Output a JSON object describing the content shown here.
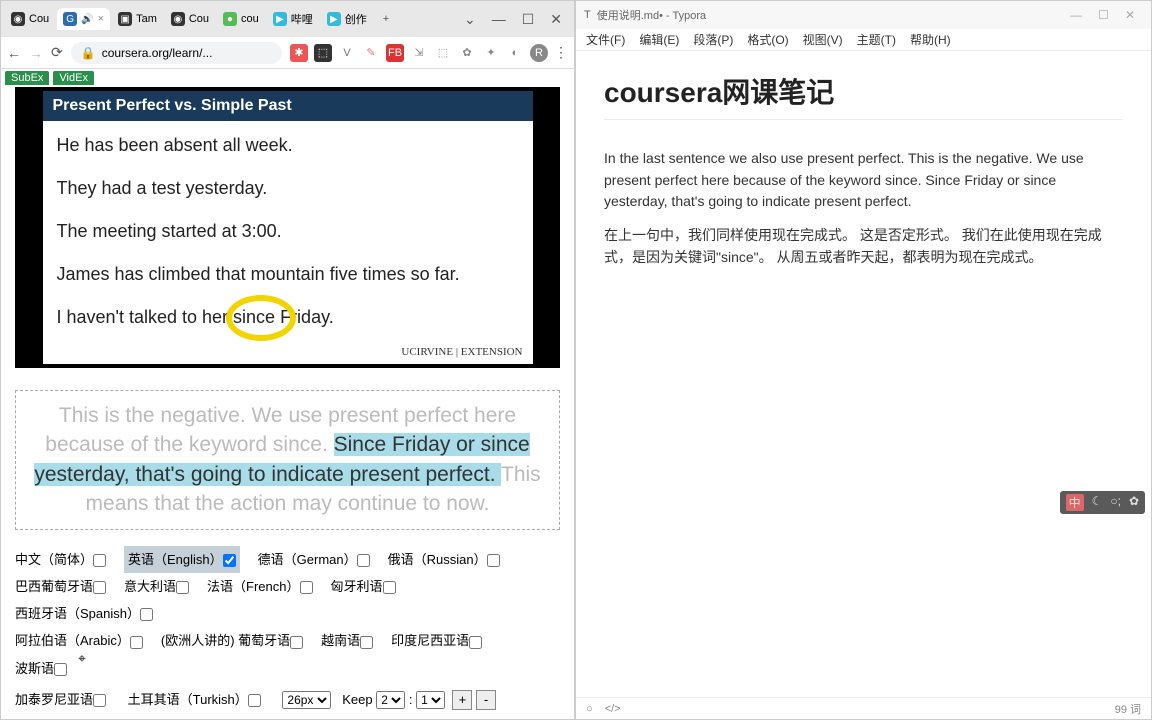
{
  "browser": {
    "tabs": [
      {
        "label": "Cou"
      },
      {
        "label": ""
      },
      {
        "label": "Tam"
      },
      {
        "label": "Cou"
      },
      {
        "label": "cou"
      },
      {
        "label": "哔哩"
      },
      {
        "label": "创作"
      }
    ],
    "url": "coursera.org/learn/...",
    "badges": {
      "subex": "SubEx",
      "videx": "VidEx"
    }
  },
  "slide": {
    "title": "Present Perfect vs. Simple Past",
    "lines": [
      "He has been absent all week.",
      "They had a test yesterday.",
      "The meeting started at 3:00.",
      "James has climbed that mountain five times so far.",
      "I haven't talked to her since Friday."
    ],
    "footer": "UCIRVINE | EXTENSION"
  },
  "caption": {
    "pre": "This is the negative.   We use present perfect here because of the keyword since.   ",
    "hl": "Since Friday or since yesterday, that's going to indicate present perfect.  ",
    "post": "This means that the action may continue to now."
  },
  "langs": {
    "row1": [
      {
        "label": "中文（简体）",
        "checked": false
      },
      {
        "label": "英语（English）",
        "checked": true,
        "sel": true
      },
      {
        "label": "德语（German）",
        "checked": false
      },
      {
        "label": "俄语（Russian）",
        "checked": false
      }
    ],
    "row2": [
      {
        "label": "巴西葡萄牙语",
        "checked": false
      },
      {
        "label": "意大利语",
        "checked": false
      },
      {
        "label": "法语（French）",
        "checked": false
      },
      {
        "label": "匈牙利语",
        "checked": false
      },
      {
        "label": "西班牙语（Spanish）",
        "checked": false
      }
    ],
    "row3": [
      {
        "label": "阿拉伯语（Arabic）",
        "checked": false
      },
      {
        "label": "(欧洲人讲的) 葡萄牙语",
        "checked": false
      },
      {
        "label": "越南语",
        "checked": false
      },
      {
        "label": "印度尼西亚语",
        "checked": false
      },
      {
        "label": "波斯语",
        "checked": false
      }
    ],
    "row4": [
      {
        "label": "加泰罗尼亚语",
        "checked": false
      },
      {
        "label": "土耳其语（Turkish）",
        "checked": false
      }
    ]
  },
  "controls": {
    "fontsize": "26px",
    "keep_label": "Keep",
    "keep_val": "2",
    "colon": ":",
    "ratio_val": "1",
    "plus": "+",
    "minus": "-"
  },
  "typora": {
    "title": "使用说明.md• - Typora",
    "menu": [
      "文件(F)",
      "编辑(E)",
      "段落(P)",
      "格式(O)",
      "视图(V)",
      "主题(T)",
      "帮助(H)"
    ],
    "h1": "coursera网课笔记",
    "p1": "In the last sentence we also use present perfect. This is the negative. We use present perfect here because of the keyword since. Since Friday or since yesterday, that's going to indicate present perfect.",
    "p2": "在上一句中，我们同样使用现在完成式。 这是否定形式。 我们在此使用现在完成式，是因为关键词\"since\"。 从周五或者昨天起，都表明为现在完成式。",
    "status_words": "99 词",
    "float": {
      "ime": "中"
    }
  }
}
